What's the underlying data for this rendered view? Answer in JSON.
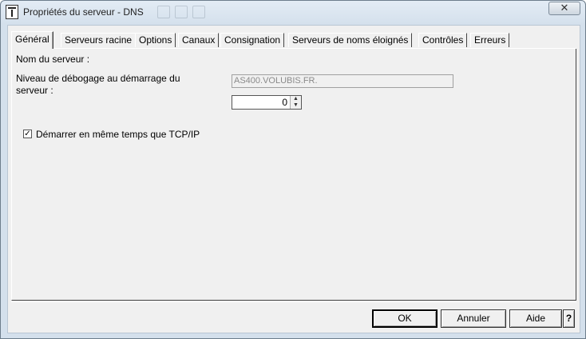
{
  "window": {
    "title": "Propriétés du serveur - DNS",
    "close_label": "✕"
  },
  "tabs": [
    {
      "label": "Général",
      "active": true
    },
    {
      "label": "Serveurs racine"
    },
    {
      "label": "Options"
    },
    {
      "label": "Canaux"
    },
    {
      "label": "Consignation"
    },
    {
      "label": "Serveurs de noms éloignés"
    },
    {
      "label": "Contrôles"
    },
    {
      "label": "Erreurs"
    }
  ],
  "general": {
    "server_name_label": "Nom du serveur :",
    "server_name_value": "AS400.VOLUBIS.FR.",
    "debug_label_line1": "Niveau de débogage au démarrage du",
    "debug_label_line2": "serveur :",
    "debug_value": "0",
    "start_with_tcpip_label": "Démarrer en même temps que TCP/IP",
    "start_with_tcpip_checked": true,
    "check_mark": "✓"
  },
  "buttons": {
    "ok": "OK",
    "cancel": "Annuler",
    "help": "Aide",
    "whats_this": "?"
  }
}
